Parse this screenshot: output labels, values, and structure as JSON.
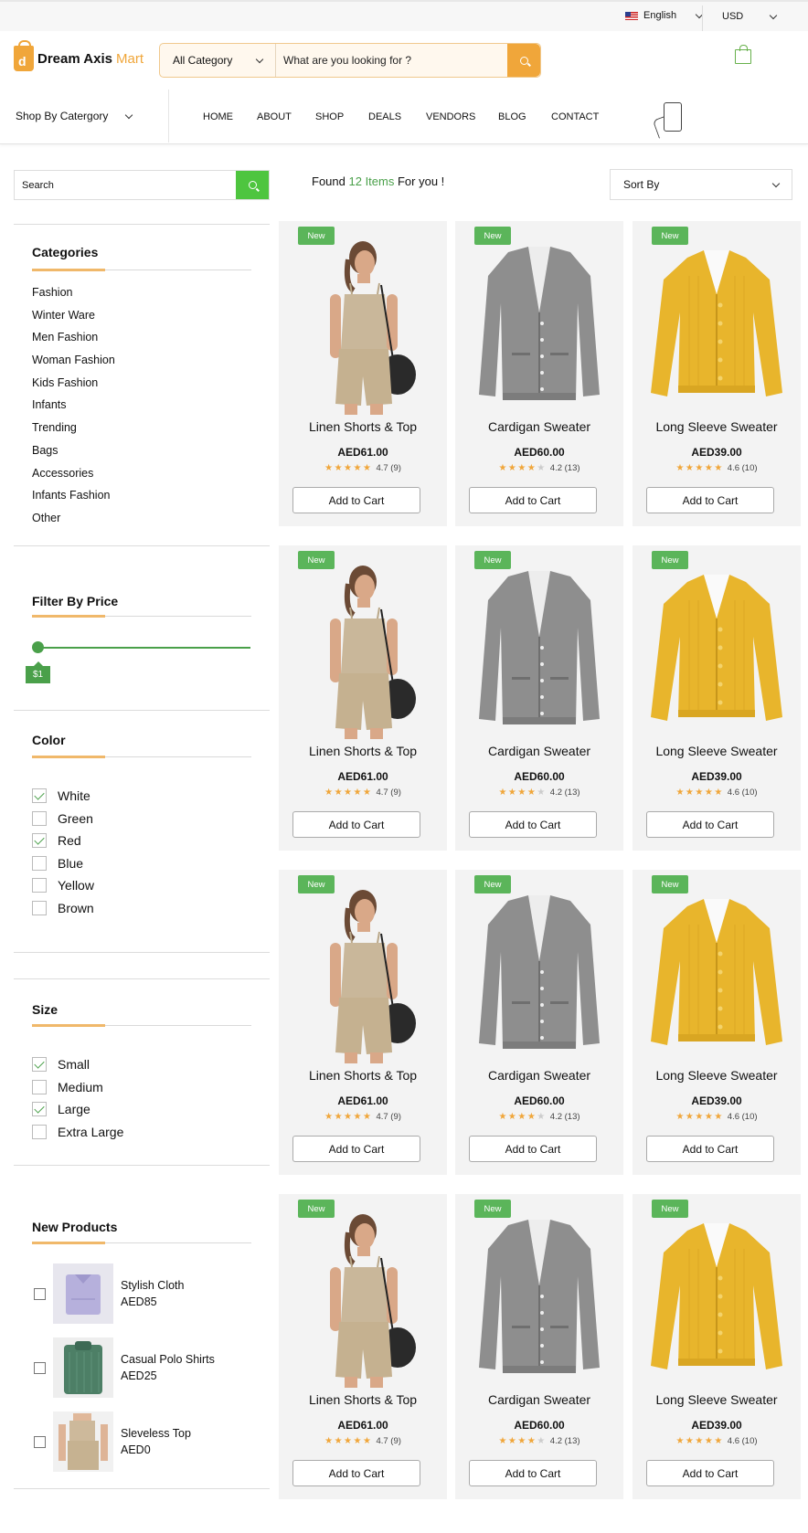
{
  "topbar": {
    "language": "English",
    "currency": "USD"
  },
  "header": {
    "logo_name": "Dream Axis",
    "logo_accent": "Mart",
    "category_select": "All Category",
    "search_placeholder": "What are you looking for ?"
  },
  "nav": {
    "shop_by_category": "Shop By Catergory",
    "links": [
      "HOME",
      "ABOUT",
      "SHOP",
      "DEALS",
      "VENDORS",
      "BLOG",
      "CONTACT"
    ]
  },
  "sidebar": {
    "search_placeholder": "Search",
    "categories_title": "Categories",
    "categories": [
      "Fashion",
      "Winter Ware",
      "Men Fashion",
      "Woman Fashion",
      "Kids Fashion",
      "Infants",
      "Trending",
      "Bags",
      "Accessories",
      "Infants Fashion",
      "Other"
    ],
    "price_title": "Filter By Price",
    "price_value": "$1",
    "color_title": "Color",
    "colors": [
      {
        "label": "White",
        "checked": true
      },
      {
        "label": "Green",
        "checked": false
      },
      {
        "label": "Red",
        "checked": true
      },
      {
        "label": "Blue",
        "checked": false
      },
      {
        "label": "Yellow",
        "checked": false
      },
      {
        "label": "Brown",
        "checked": false
      }
    ],
    "size_title": "Size",
    "sizes": [
      {
        "label": "Small",
        "checked": true
      },
      {
        "label": "Medium",
        "checked": false
      },
      {
        "label": "Large",
        "checked": true
      },
      {
        "label": "Extra Large",
        "checked": false
      }
    ],
    "new_products_title": "New Products",
    "new_products": [
      {
        "name": "Stylish Cloth",
        "price": "AED85"
      },
      {
        "name": "Casual Polo Shirts",
        "price": "AED25"
      },
      {
        "name": "Sleveless Top",
        "price": "AED0"
      }
    ]
  },
  "listing": {
    "found_prefix": "Found",
    "found_count": "12 Items",
    "found_suffix": "For you !",
    "sort_label": "Sort By"
  },
  "products": [
    {
      "badge": "New",
      "name": "Linen Shorts & Top",
      "price": "AED61.00",
      "rating": "4.7 (9)",
      "stars": 4.7,
      "image": "linen-set",
      "button": "Add to Cart"
    },
    {
      "badge": "New",
      "name": "Cardigan Sweater",
      "price": "AED60.00",
      "rating": "4.2 (13)",
      "stars": 4.2,
      "image": "grey-cardigan",
      "button": "Add to Cart"
    },
    {
      "badge": "New",
      "name": "Long Sleeve Sweater",
      "price": "AED39.00",
      "rating": "4.6 (10)",
      "stars": 4.6,
      "image": "yellow-sweater",
      "button": "Add to Cart"
    },
    {
      "badge": "New",
      "name": "Linen Shorts & Top",
      "price": "AED61.00",
      "rating": "4.7 (9)",
      "stars": 4.7,
      "image": "linen-set",
      "button": "Add to Cart"
    },
    {
      "badge": "New",
      "name": "Cardigan Sweater",
      "price": "AED60.00",
      "rating": "4.2 (13)",
      "stars": 4.2,
      "image": "grey-cardigan",
      "button": "Add to Cart"
    },
    {
      "badge": "New",
      "name": "Long Sleeve Sweater",
      "price": "AED39.00",
      "rating": "4.6 (10)",
      "stars": 4.6,
      "image": "yellow-sweater",
      "button": "Add to Cart"
    },
    {
      "badge": "New",
      "name": "Linen Shorts & Top",
      "price": "AED61.00",
      "rating": "4.7 (9)",
      "stars": 4.7,
      "image": "linen-set",
      "button": "Add to Cart"
    },
    {
      "badge": "New",
      "name": "Cardigan Sweater",
      "price": "AED60.00",
      "rating": "4.2 (13)",
      "stars": 4.2,
      "image": "grey-cardigan",
      "button": "Add to Cart"
    },
    {
      "badge": "New",
      "name": "Long Sleeve Sweater",
      "price": "AED39.00",
      "rating": "4.6 (10)",
      "stars": 4.6,
      "image": "yellow-sweater",
      "button": "Add to Cart"
    },
    {
      "badge": "New",
      "name": "Linen Shorts & Top",
      "price": "AED61.00",
      "rating": "4.7 (9)",
      "stars": 4.7,
      "image": "linen-set",
      "button": "Add to Cart"
    },
    {
      "badge": "New",
      "name": "Cardigan Sweater",
      "price": "AED60.00",
      "rating": "4.2 (13)",
      "stars": 4.2,
      "image": "grey-cardigan",
      "button": "Add to Cart"
    },
    {
      "badge": "New",
      "name": "Long Sleeve Sweater",
      "price": "AED39.00",
      "rating": "4.6 (10)",
      "stars": 4.6,
      "image": "yellow-sweater",
      "button": "Add to Cart"
    }
  ],
  "colors": {
    "accent_orange": "#f0a63a",
    "accent_green": "#4aa04a",
    "badge_green": "#5bb55a",
    "card_bg": "#f3f3f3"
  }
}
